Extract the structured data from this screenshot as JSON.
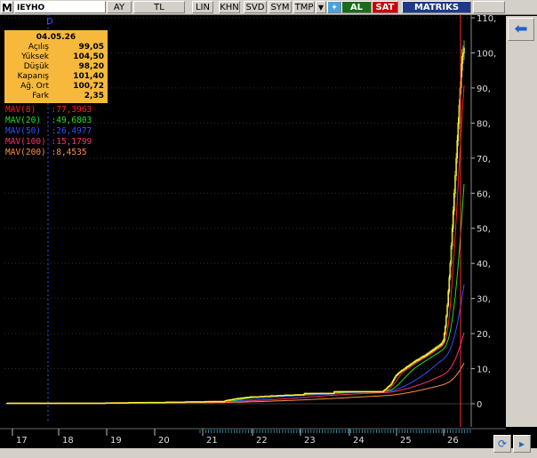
{
  "toolbar": {
    "logo": "M",
    "symbol": "IEYHO",
    "buttons": [
      "AY",
      "TL",
      "LIN",
      "KHN",
      "SVD",
      "SYM",
      "TMP"
    ],
    "al_label": "AL",
    "sat_label": "SAT",
    "brand": "MATRIKS"
  },
  "marker_label": "D",
  "info": {
    "date": "04.05.26",
    "rows": [
      {
        "k": "Açılış",
        "v": "99,05"
      },
      {
        "k": "Yüksek",
        "v": "104,50"
      },
      {
        "k": "Düşük",
        "v": "98,20"
      },
      {
        "k": "Kapanış",
        "v": "101,40"
      },
      {
        "k": "Ağ. Ort",
        "v": "100,72"
      },
      {
        "k": "Fark",
        "v": "2,35"
      }
    ]
  },
  "mav": [
    {
      "label": "MAV(8)",
      "value": ":77,3963",
      "color": "#ff2020"
    },
    {
      "label": "MAV(20)",
      "value": ":49,6803",
      "color": "#22dd22"
    },
    {
      "label": "MAV(50)",
      "value": ":26,4977",
      "color": "#3050ff"
    },
    {
      "label": "MAV(100)",
      "value": ":15,1799",
      "color": "#ff3070"
    },
    {
      "label": "MAV(200)",
      "value": ":8,4535",
      "color": "#ff9040"
    }
  ],
  "chart_data": {
    "type": "candlestick",
    "ylim": [
      0,
      110
    ],
    "yticks": [
      0,
      10,
      20,
      30,
      40,
      50,
      60,
      70,
      80,
      90,
      100,
      110
    ],
    "xticks": [
      "17",
      "18",
      "19",
      "20",
      "21",
      "22",
      "23",
      "24",
      "25",
      "26"
    ],
    "candle_color": "#ffff40",
    "colors": {
      "mav8": "#ff2020",
      "mav20": "#22dd22",
      "mav50": "#3050ff",
      "mav100": "#ff3070",
      "mav200": "#ff9040"
    },
    "closes": [
      0.2,
      0.2,
      0.2,
      0.2,
      0.2,
      0.2,
      0.2,
      0.2,
      0.2,
      0.2,
      0.2,
      0.2,
      0.2,
      0.2,
      0.2,
      0.2,
      0.2,
      0.2,
      0.2,
      0.2,
      0.2,
      0.2,
      0.2,
      0.2,
      0.2,
      0.2,
      0.2,
      0.2,
      0.2,
      0.2,
      0.2,
      0.2,
      0.2,
      0.2,
      0.2,
      0.2,
      0.2,
      0.2,
      0.2,
      0.2,
      0.2,
      0.2,
      0.2,
      0.2,
      0.2,
      0.2,
      0.2,
      0.2,
      0.2,
      0.2,
      0.2,
      0.2,
      0.2,
      0.2,
      0.2,
      0.2,
      0.2,
      0.2,
      0.2,
      0.2,
      0.2,
      0.2,
      0.2,
      0.2,
      0.2,
      0.2,
      0.2,
      0.2,
      0.2,
      0.2,
      0.2,
      0.2,
      0.2,
      0.2,
      0.2,
      0.2,
      0.2,
      0.2,
      0.2,
      0.2,
      0.2,
      0.2,
      0.2,
      0.2,
      0.2,
      0.2,
      0.2,
      0.2,
      0.2,
      0.2,
      0.2,
      0.2,
      0.2,
      0.2,
      0.2,
      0.2,
      0.2,
      0.2,
      0.2,
      0.2,
      0.3,
      0.3,
      0.3,
      0.3,
      0.3,
      0.3,
      0.3,
      0.3,
      0.3,
      0.3,
      0.3,
      0.3,
      0.3,
      0.3,
      0.3,
      0.3,
      0.3,
      0.3,
      0.3,
      0.3,
      0.3,
      0.3,
      0.3,
      0.4,
      0.4,
      0.4,
      0.4,
      0.4,
      0.4,
      0.4,
      0.4,
      0.4,
      0.4,
      0.4,
      0.4,
      0.4,
      0.4,
      0.4,
      0.4,
      0.4,
      0.4,
      0.4,
      0.4,
      0.4,
      0.4,
      0.4,
      0.4,
      0.4,
      0.4,
      0.4,
      0.4,
      0.4,
      0.4,
      0.4,
      0.4,
      0.4,
      0.4,
      0.4,
      0.4,
      0.4,
      0.5,
      0.5,
      0.5,
      0.5,
      0.5,
      0.5,
      0.5,
      0.5,
      0.5,
      0.5,
      0.5,
      0.5,
      0.5,
      0.5,
      0.5,
      0.5,
      0.5,
      0.5,
      0.5,
      0.5,
      0.6,
      0.6,
      0.6,
      0.6,
      0.6,
      0.6,
      0.6,
      0.6,
      0.6,
      0.6,
      0.6,
      0.6,
      0.6,
      0.6,
      0.6,
      0.6,
      0.6,
      0.6,
      0.6,
      0.6,
      0.7,
      0.7,
      0.7,
      0.7,
      0.7,
      0.7,
      0.7,
      0.7,
      0.7,
      0.7,
      0.7,
      0.7,
      0.7,
      0.7,
      0.7,
      0.7,
      0.7,
      0.7,
      0.7,
      0.7,
      0.9,
      1.0,
      1.0,
      1.1,
      1.1,
      1.2,
      1.2,
      1.3,
      1.3,
      1.4,
      1.4,
      1.5,
      1.5,
      1.6,
      1.6,
      1.6,
      1.7,
      1.7,
      1.7,
      1.8,
      1.8,
      1.8,
      1.9,
      1.9,
      1.9,
      2.0,
      2.0,
      2.0,
      2.0,
      2.0,
      2.0,
      2.0,
      2.0,
      2.0,
      2.0,
      2.1,
      2.1,
      2.1,
      2.1,
      2.1,
      2.2,
      2.2,
      2.2,
      2.2,
      2.2,
      2.2,
      2.3,
      2.3,
      2.3,
      2.3,
      2.3,
      2.3,
      2.3,
      2.4,
      2.4,
      2.4,
      2.4,
      2.4,
      2.4,
      2.4,
      2.5,
      2.5,
      2.5,
      2.5,
      2.5,
      2.5,
      2.5,
      2.5,
      2.5,
      2.5,
      2.6,
      2.6,
      2.6,
      2.6,
      2.6,
      2.6,
      2.6,
      2.6,
      2.6,
      2.6,
      3.0,
      3.0,
      3.0,
      3.0,
      3.0,
      3.0,
      3.0,
      3.0,
      3.0,
      3.0,
      3.0,
      3.0,
      3.0,
      3.0,
      3.0,
      3.0,
      3.0,
      3.0,
      3.0,
      3.0,
      3.0,
      3.0,
      3.0,
      3.0,
      3.0,
      3.0,
      3.0,
      3.0,
      3.0,
      3.0,
      3.5,
      3.5,
      3.5,
      3.5,
      3.5,
      3.5,
      3.5,
      3.5,
      3.5,
      3.5,
      3.5,
      3.5,
      3.5,
      3.5,
      3.5,
      3.5,
      3.5,
      3.5,
      3.5,
      3.5,
      3.5,
      3.5,
      3.5,
      3.5,
      3.5,
      3.5,
      3.5,
      3.5,
      3.5,
      3.5,
      3.5,
      3.5,
      3.5,
      3.5,
      3.5,
      3.5,
      3.5,
      3.5,
      3.5,
      3.5,
      3.5,
      3.5,
      3.5,
      3.5,
      3.5,
      3.5,
      3.5,
      3.5,
      3.5,
      3.5,
      3.8,
      4.0,
      4.2,
      4.5,
      4.8,
      5.0,
      5.2,
      5.5,
      6.0,
      6.5,
      7.0,
      7.5,
      8.0,
      8.2,
      8.5,
      8.8,
      9.0,
      9.2,
      9.5,
      9.6,
      9.8,
      10.0,
      10.2,
      10.5,
      10.6,
      10.8,
      11.0,
      11.2,
      11.4,
      11.6,
      11.8,
      12.0,
      12.2,
      12.4,
      12.5,
      12.6,
      12.8,
      13.0,
      13.2,
      13.4,
      13.5,
      13.6,
      13.8,
      14.0,
      14.2,
      14.4,
      14.6,
      14.8,
      15.0,
      15.2,
      15.4,
      15.6,
      15.8,
      16.0,
      16.2,
      16.4,
      16.6,
      16.8,
      17.0,
      17.5,
      18.0,
      20.0,
      22.0,
      25.0,
      28.0,
      32.0,
      36.0,
      40.0,
      45.0,
      50.0,
      55.0,
      60.0,
      65.0,
      70.0,
      75.0,
      80.0,
      85.0,
      90.0,
      95.0,
      99.0,
      100.0,
      101.4
    ]
  }
}
